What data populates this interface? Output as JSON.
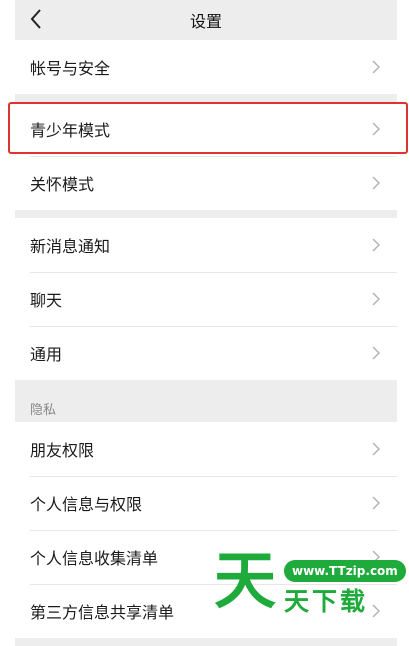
{
  "header": {
    "title": "设置"
  },
  "group1": {
    "items": [
      {
        "label": "帐号与安全"
      }
    ]
  },
  "group2": {
    "items": [
      {
        "label": "青少年模式"
      },
      {
        "label": "关怀模式"
      }
    ]
  },
  "group3": {
    "items": [
      {
        "label": "新消息通知"
      },
      {
        "label": "聊天"
      },
      {
        "label": "通用"
      }
    ]
  },
  "privacy": {
    "section_title": "隐私",
    "items": [
      {
        "label": "朋友权限"
      },
      {
        "label": "个人信息与权限"
      },
      {
        "label": "个人信息收集清单"
      },
      {
        "label": "第三方信息共享清单"
      }
    ]
  },
  "watermark": {
    "big": "天",
    "url": "www.TTzip.com",
    "sub": "天下载"
  },
  "colors": {
    "highlight": "#e0332e",
    "watermark": "#1faa3c",
    "background": "#ededed"
  }
}
